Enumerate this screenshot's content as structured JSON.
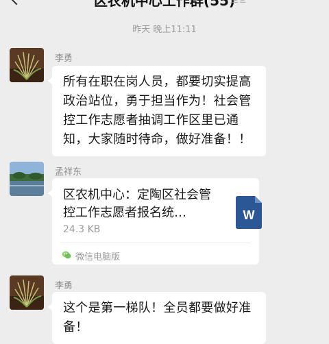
{
  "header": {
    "title": "区农机中心工作群(55)",
    "subtitle": "≥≥"
  },
  "timestamp": "昨天 晚上11:11",
  "messages": [
    {
      "sender": "李勇",
      "text": "所有在职在岗人员，都要切实提高政治站位，勇于担当作为！社会管控工作志愿者抽调工作区里已通知，大家随时待命，做好准备！！"
    },
    {
      "sender": "孟祥东",
      "file": {
        "name": "区农机中心：定陶区社会管控工作志愿者报名统…",
        "size": "24.3 KB",
        "source": "微信电脑版",
        "icon": "word-document-icon"
      }
    },
    {
      "sender": "李勇",
      "text": "这个是第一梯队！全员都要做好准备！"
    }
  ],
  "colors": {
    "background": "#ededed",
    "bubble": "#ffffff",
    "word_blue": "#2b5797"
  }
}
